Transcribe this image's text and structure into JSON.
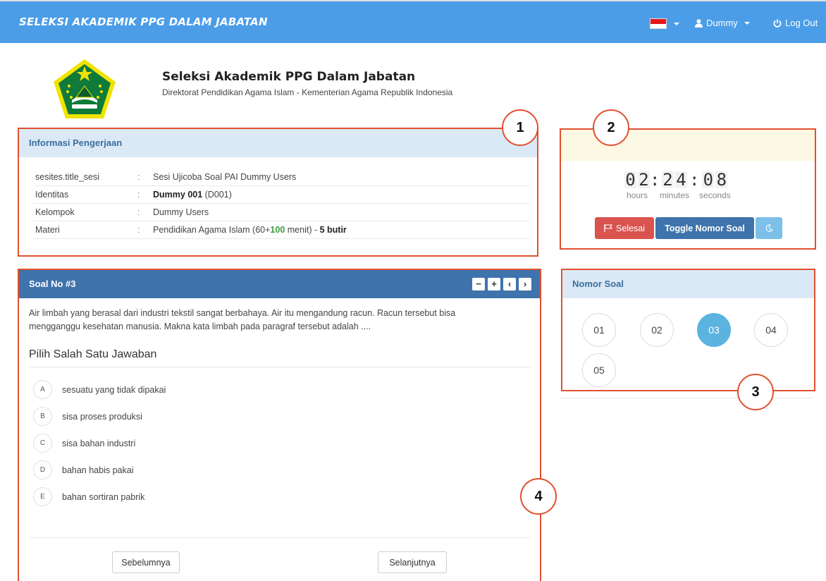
{
  "navbar": {
    "brand": "SELEKSI AKADEMIK PPG DALAM JABATAN",
    "user_label": "Dummy",
    "logout_label": "Log Out"
  },
  "header": {
    "title": "Seleksi Akademik PPG Dalam Jabatan",
    "subtitle": "Direktorat Pendidikan Agama Islam - Kementerian Agama Republik Indonesia"
  },
  "info": {
    "heading": "Informasi Pengerjaan",
    "rows": [
      {
        "key": "sesites.title_sesi",
        "sep": ":",
        "value": "Sesi Ujicoba Soal PAI Dummy Users"
      },
      {
        "key": "Identitas",
        "sep": ":",
        "value_bold": "Dummy 001",
        "value_rest": " (D001)"
      },
      {
        "key": "Kelompok",
        "sep": ":",
        "value": "Dummy Users"
      },
      {
        "key": "Materi",
        "sep": ":",
        "value_a": "Pendidikan Agama Islam (60+",
        "value_green": "100",
        "value_b": " menit) - ",
        "value_bold": "5 butir"
      }
    ]
  },
  "timer": {
    "hours": [
      "0",
      "2"
    ],
    "minutes": [
      "2",
      "4"
    ],
    "seconds": [
      "0",
      "8"
    ],
    "colon": ":",
    "hours_label": "hours",
    "minutes_label": "minutes",
    "seconds_label": "seconds",
    "finish_label": "Selesai",
    "toggle_label": "Toggle Nomor Soal"
  },
  "nomor": {
    "heading": "Nomor Soal",
    "items": [
      "01",
      "02",
      "03",
      "04",
      "05"
    ],
    "active": "03"
  },
  "soal": {
    "heading": "Soal No #3",
    "tools": [
      "−",
      "+",
      "‹",
      "›"
    ],
    "question_line1": "Air limbah yang berasal dari industri tekstil sangat berbahaya. Air itu mengandung racun. Racun tersebut bisa",
    "question_line2": "mengganggu kesehatan manusia. Makna kata limbah pada paragraf tersebut adalah ....",
    "instruction": "Pilih Salah Satu Jawaban",
    "options": [
      {
        "letter": "A",
        "text": "sesuatu yang tidak dipakai"
      },
      {
        "letter": "B",
        "text": "sisa proses produksi"
      },
      {
        "letter": "C",
        "text": "sisa bahan industri"
      },
      {
        "letter": "D",
        "text": "bahan habis pakai"
      },
      {
        "letter": "E",
        "text": "bahan sortiran pabrik"
      }
    ],
    "prev_label": "Sebelumnya",
    "next_label": "Selanjutnya"
  },
  "callouts": [
    "1",
    "2",
    "3",
    "4"
  ],
  "colors": {
    "navbar": "#4b9de8",
    "highlight_border": "#e0502e",
    "panel_head_light": "#dbe9f6",
    "panel_head_dark": "#3f73ac",
    "active_number": "#5bb4e0",
    "finish_button": "#d9534f"
  }
}
